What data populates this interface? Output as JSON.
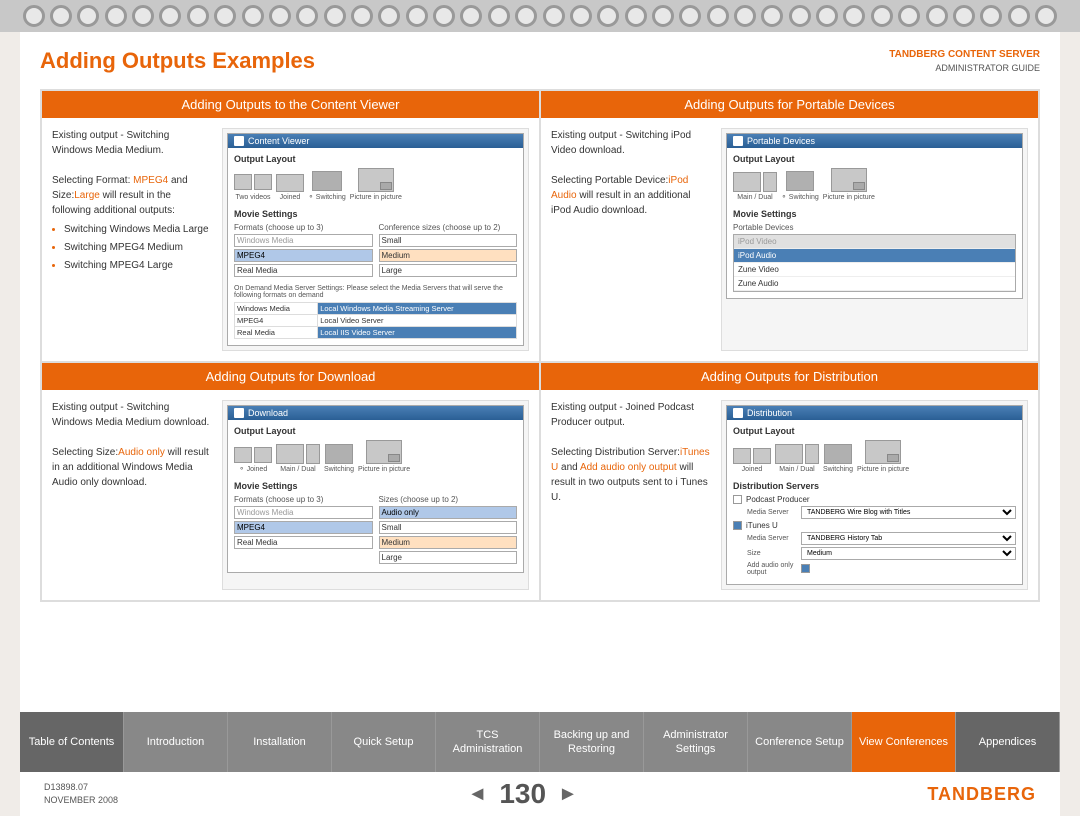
{
  "spiral": {
    "rings": [
      1,
      2,
      3,
      4,
      5,
      6,
      7,
      8,
      9,
      10,
      11,
      12,
      13,
      14,
      15,
      16,
      17,
      18,
      19,
      20,
      21,
      22,
      23,
      24,
      25,
      26,
      27,
      28,
      29,
      30,
      31,
      32,
      33,
      34,
      35,
      36,
      37,
      38,
      39,
      40
    ]
  },
  "header": {
    "title": "Adding Outputs Examples",
    "brand_line1_plain": "TANDBERG ",
    "brand_line1_highlight": "CONTENT SERVER",
    "brand_line2": "ADMINISTRATOR GUIDE"
  },
  "sections": {
    "top_left": {
      "header": "Adding Outputs to the Content Viewer",
      "text_line1": "Existing output - Switching Windows Media Medium.",
      "text_line2": "Selecting Format: ",
      "format_highlight": "MPEG4",
      "text_line2b": " and Size:",
      "size_highlight": "Large",
      "text_line2c": " will result in the following additional outputs:",
      "bullets": [
        "Switching Windows Media Large",
        "Switching MPEG4 Medium",
        "Switching MPEG4 Large"
      ],
      "window_title": "Content Viewer",
      "output_layout_label": "Output Layout",
      "layout_items": [
        "Two videos",
        "Joined",
        "Switching",
        "Picture in picture"
      ],
      "movie_settings_label": "Movie Settings",
      "formats_label": "Formats (choose up to 3)",
      "sizes_label": "Conference sizes (choose up to 2)",
      "format_items": [
        "Windows Media",
        "MPEG4",
        "Real Media"
      ],
      "format_selected": "MPEG4",
      "size_items": [
        "Small",
        "Medium",
        "Large"
      ],
      "size_selected": "Medium",
      "on_demand_label": "On Demand Media Server Settings",
      "on_demand_desc": "Please select the Media Servers that will serve the following formats on demand",
      "on_demand_rows": [
        {
          "label": "Windows Media",
          "value": "Local Windows Media Streaming Server"
        },
        {
          "label": "MPEG4",
          "value": "Local Video Server"
        },
        {
          "label": "Real Media",
          "value": "Local IIS Video Server"
        }
      ]
    },
    "top_right": {
      "header": "Adding Outputs for Portable Devices",
      "text_line1": "Existing output - Switching iPod Video download.",
      "text_line2": "Selecting Portable Device:",
      "device_highlight": "iPod Audio",
      "text_line2b": " will result in an additional iPod Audio download.",
      "window_title": "Portable Devices",
      "output_layout_label": "Output Layout",
      "layout_items": [
        "Switching",
        "Picture in picture"
      ],
      "movie_settings_label": "Movie Settings",
      "devices_label": "Portable Devices",
      "devices": [
        {
          "name": "iPod Video",
          "state": "greyed"
        },
        {
          "name": "iPod Audio",
          "state": "selected"
        },
        {
          "name": "Zune Video",
          "state": "normal"
        },
        {
          "name": "Zune Audio",
          "state": "normal"
        }
      ]
    },
    "bottom_left": {
      "header": "Adding Outputs for Download",
      "text_line1": "Existing output - Switching Windows Media Medium download.",
      "text_line2": "Selecting Size:",
      "size_highlight": "Audio only",
      "text_line2b": " will result in an additional Windows Media Audio only download.",
      "window_title": "Download",
      "output_layout_label": "Output Layout",
      "layout_items": [
        "Joined",
        "Switching",
        "Picture in picture"
      ],
      "movie_settings_label": "Movie Settings",
      "formats_label": "Formats (choose up to 3)",
      "sizes_label": "Sizes (choose up to 2)",
      "format_items": [
        "Windows Media",
        "MPEG4",
        "Real Media"
      ],
      "size_items": [
        "Audio only",
        "Small",
        "Medium",
        "Large"
      ],
      "size_selected": "Audio only"
    },
    "bottom_right": {
      "header": "Adding Outputs for Distribution",
      "text_line1": "Existing output - Joined Podcast Producer output.",
      "text_line2": "Selecting Distribution Server:",
      "server_highlight1": "iTunes U",
      "text_line2b": " and ",
      "server_highlight2": "Add audio only output",
      "text_line2c": " will result in two outputs sent to i Tunes U.",
      "window_title": "Distribution",
      "output_layout_label": "Output Layout",
      "layout_items": [
        "Joined",
        "Switching",
        "Picture in picture"
      ],
      "dist_servers_label": "Distribution Servers",
      "servers": [
        {
          "name": "Podcast Producer",
          "checked": false,
          "sub": [
            {
              "label": "Media Server",
              "value": "TANDBERG Wire Blog with Titles"
            }
          ]
        },
        {
          "name": "iTunes U",
          "checked": true,
          "sub": [
            {
              "label": "Media Server",
              "value": "TANDBERG History Tab"
            },
            {
              "label": "Size",
              "value": "Medium"
            },
            {
              "label": "Add audio only output",
              "value": "checked"
            }
          ]
        }
      ]
    }
  },
  "nav": {
    "tabs": [
      {
        "id": "table-of-contents",
        "label": "Table of Contents",
        "active": false
      },
      {
        "id": "introduction",
        "label": "Introduction",
        "active": false
      },
      {
        "id": "installation",
        "label": "Installation",
        "active": false
      },
      {
        "id": "quick-setup",
        "label": "Quick Setup",
        "active": false
      },
      {
        "id": "tcs-administration",
        "label": "TCS Administration",
        "active": false
      },
      {
        "id": "backing-up-restoring",
        "label": "Backing up and Restoring",
        "active": false
      },
      {
        "id": "administrator-settings",
        "label": "Administrator Settings",
        "active": false
      },
      {
        "id": "conference-setup",
        "label": "Conference Setup",
        "active": false
      },
      {
        "id": "view-conferences",
        "label": "View Conferences",
        "active": true
      },
      {
        "id": "appendices",
        "label": "Appendices",
        "active": false
      }
    ]
  },
  "footer": {
    "doc_number": "D13898.07",
    "date": "NOVEMBER 2008",
    "page_number": "130",
    "arrow_left": "◄",
    "arrow_right": "►",
    "brand": "TANDBERG"
  }
}
